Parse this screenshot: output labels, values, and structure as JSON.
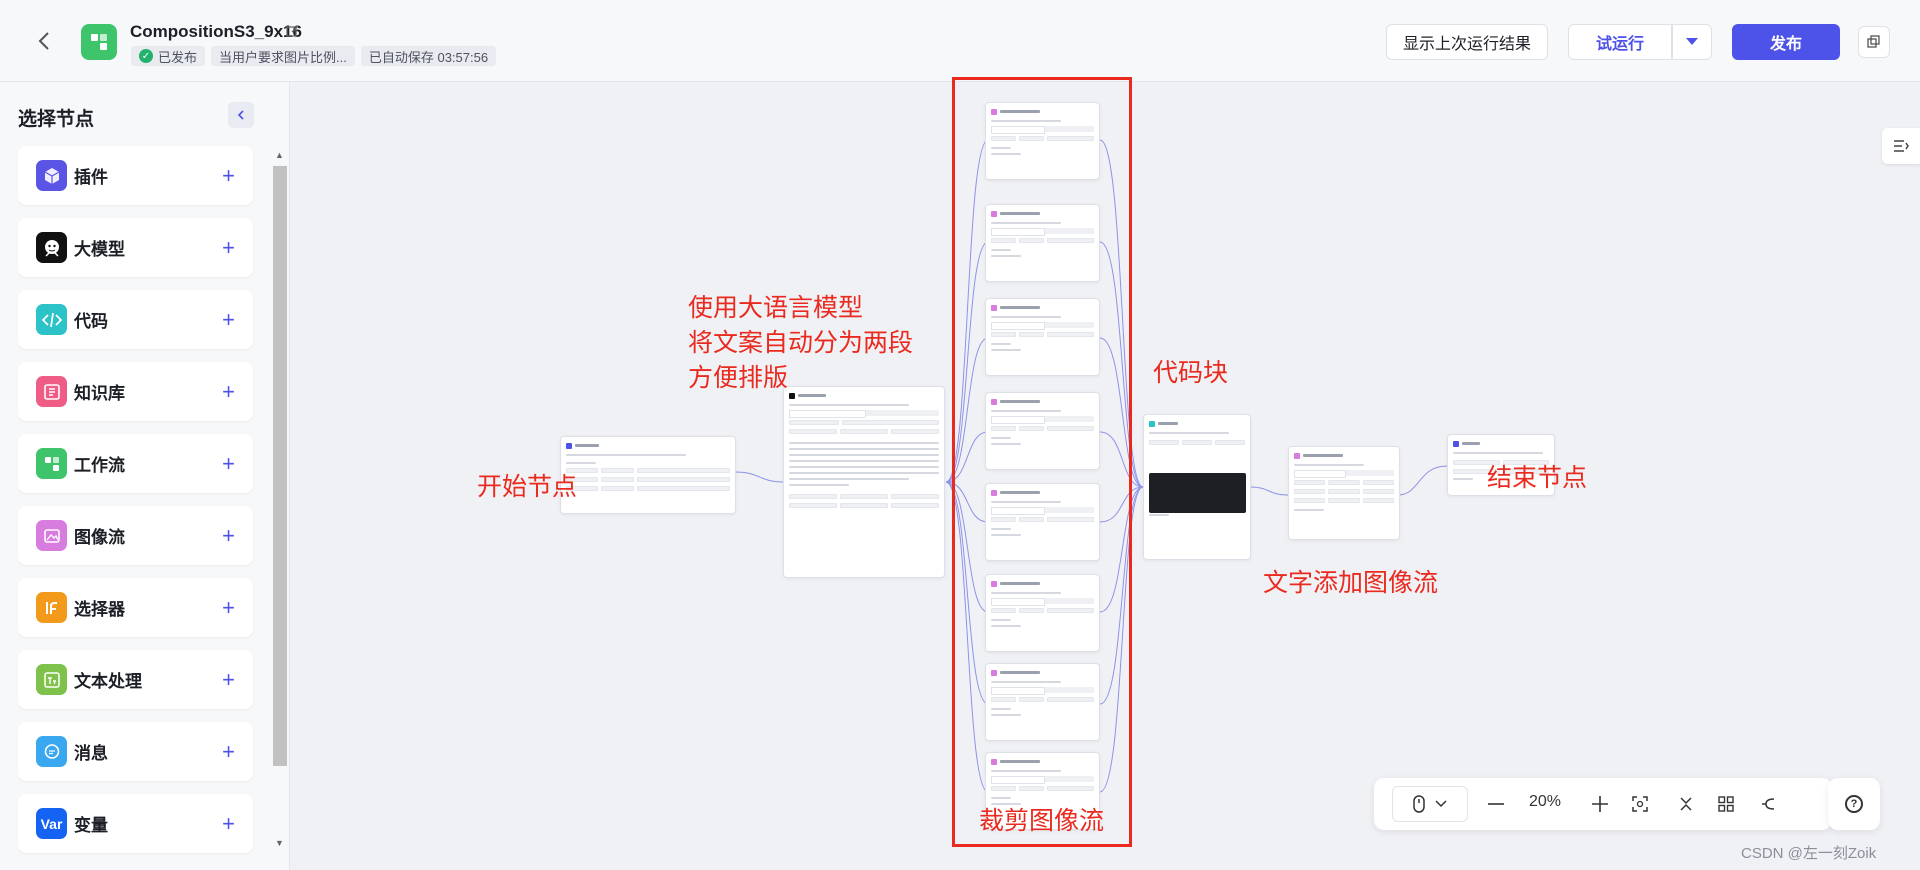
{
  "header": {
    "title": "CompositionS3_9x16",
    "status_published": "已发布",
    "description_chip": "当用户要求图片比例...",
    "autosave": "已自动保存 03:57:56",
    "btn_last_run": "显示上次运行结果",
    "btn_trial_run": "试运行",
    "btn_publish": "发布"
  },
  "sidebar": {
    "title": "选择节点",
    "items": [
      {
        "label": "插件",
        "icon": "plugin-icon",
        "color": "#5b55e6"
      },
      {
        "label": "大模型",
        "icon": "llm-icon",
        "color": "#111111"
      },
      {
        "label": "代码",
        "icon": "code-icon",
        "color": "#2bc2c8"
      },
      {
        "label": "知识库",
        "icon": "knowledge-icon",
        "color": "#ef5d86"
      },
      {
        "label": "工作流",
        "icon": "workflow-icon",
        "color": "#3ec46b"
      },
      {
        "label": "图像流",
        "icon": "imageflow-icon",
        "color": "#d87ce0"
      },
      {
        "label": "选择器",
        "icon": "selector-icon",
        "color": "#f39a1c"
      },
      {
        "label": "文本处理",
        "icon": "text-icon",
        "color": "#7ec24b"
      },
      {
        "label": "消息",
        "icon": "message-icon",
        "color": "#3aa8f0"
      },
      {
        "label": "变量",
        "icon": "variable-icon",
        "color": "#1463f2",
        "glyph": "Var"
      }
    ]
  },
  "annotations": {
    "start": "开始节点",
    "llm_line1": "使用大语言模型",
    "llm_line2": "将文案自动分为两段",
    "llm_line3": "方便排版",
    "code": "代码块",
    "crop": "裁剪图像流",
    "text_image": "文字添加图像流",
    "end": "结束节点"
  },
  "toolbar": {
    "zoom": "20%"
  },
  "watermark": "CSDN @左一刻Zoik",
  "colors": {
    "accent": "#4d53e8",
    "annotation_red": "#ea2a1f",
    "published_green": "#23b26d"
  }
}
